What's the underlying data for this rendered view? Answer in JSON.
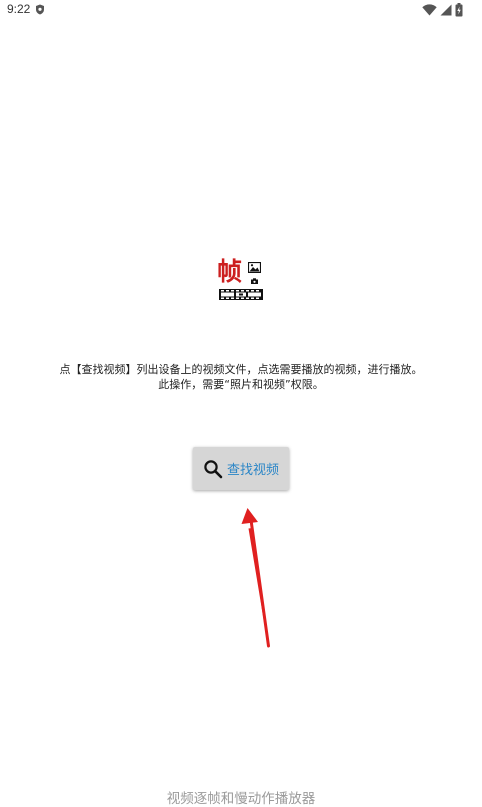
{
  "status_bar": {
    "time": "9:22"
  },
  "logo": {
    "character": "帧"
  },
  "description": {
    "line1": "点【查找视频】列出设备上的视频文件，点选需要播放的视频，进行播放。",
    "line2": "此操作，需要“照片和视频”权限。"
  },
  "find_button": {
    "label": "查找视频",
    "icon": "search-icon"
  },
  "footer": {
    "app_name": "视频逐帧和慢动作播放器"
  },
  "colors": {
    "logo_red": "#cc1f1f",
    "button_bg": "#d6d6d6",
    "button_text": "#2b86c7",
    "annotation_red": "#e02020",
    "footer_text": "#9a9a9a"
  }
}
